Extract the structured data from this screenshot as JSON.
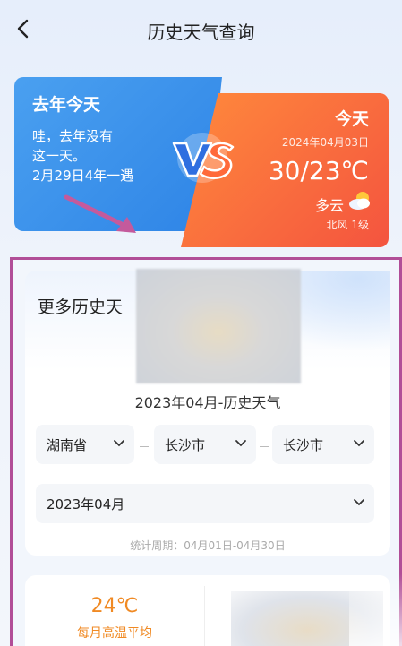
{
  "header": {
    "title": "历史天气查询",
    "back_icon": "chevron-left-icon"
  },
  "last_year": {
    "title": "去年今天",
    "lines": [
      "哇，去年没有",
      "这一天。",
      "2月29日4年一遇"
    ]
  },
  "today": {
    "title": "今天",
    "date": "2024年04月03日",
    "temp": "30/23℃",
    "condition": "多云",
    "wind": "北风 1级"
  },
  "more": {
    "title": "更多历史天",
    "history_label": "2023年04月-历史天气",
    "province": "湖南省",
    "city": "长沙市",
    "district": "长沙市",
    "month": "2023年04月",
    "period": "统计周期：04月01日-04月30日"
  },
  "summary": {
    "temp": "24℃",
    "label": "每月高温平均"
  },
  "colors": {
    "highlight": "#b14e97",
    "last_year_blue": "#2e84e6",
    "today_orange": "#f4543f",
    "summary_orange": "#f08a24"
  }
}
